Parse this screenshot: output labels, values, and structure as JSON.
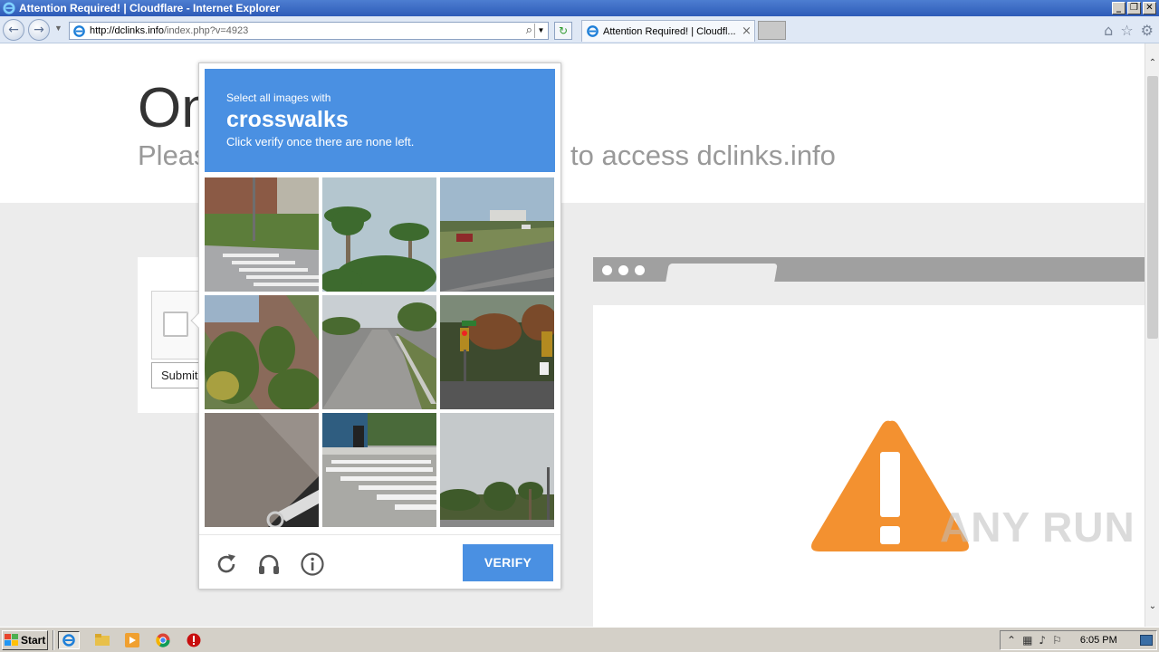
{
  "window": {
    "title": "Attention Required! | Cloudflare - Internet Explorer",
    "buttons": {
      "minimize": "_",
      "restore": "❐",
      "close": "✕"
    }
  },
  "nav": {
    "back_icon": "back-arrow-icon",
    "forward_icon": "forward-arrow-icon",
    "url_host": "http://dclinks.info",
    "url_rest": "/index.php?v=4923",
    "tab_label": "Attention Required! | Cloudfl...",
    "tab_close": "×"
  },
  "page": {
    "heading": "On",
    "subheading_left": "Pleas",
    "subheading_right": "to access dclinks.info",
    "submit_label": "Submit"
  },
  "challenge": {
    "instruction_small": "Select all images with",
    "target": "crosswalks",
    "instruction_sub": "Click verify once there are none left.",
    "verify_label": "VERIFY",
    "tiles": [
      "crosswalk-near-brick-building",
      "palm-trees",
      "highway-with-cars",
      "trees-and-building",
      "road-with-lane",
      "traffic-lights",
      "sidewalk-and-car",
      "crosswalk-at-bus-stop",
      "palm-trees-and-street"
    ]
  },
  "watermark": "ANY RUN",
  "taskbar": {
    "start_label": "Start",
    "clock": "6:05 PM",
    "colors": {
      "accent": "#4a90e2",
      "warning": "#f39130"
    }
  }
}
